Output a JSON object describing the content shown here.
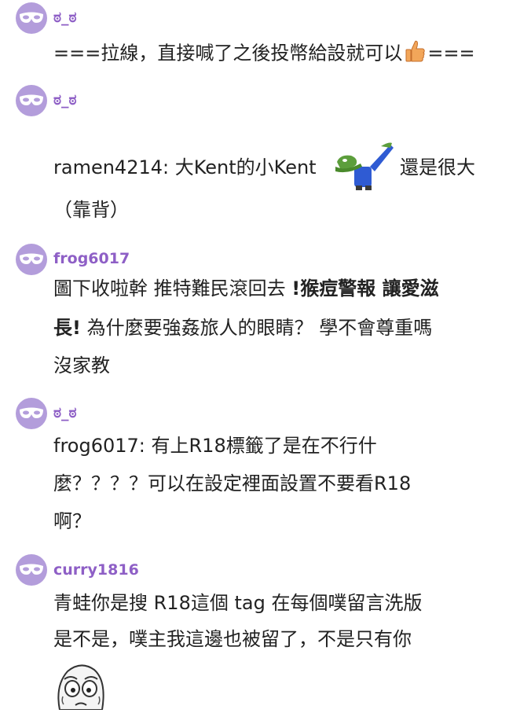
{
  "comments": [
    {
      "username": "ಠ_ಠ",
      "lines": [
        "===拉線，直接喊了之後投幣給設就可以",
        "==="
      ]
    },
    {
      "username": "ಠ_ಠ",
      "lines": [
        "ramen4214: 大Kent的小Kent",
        "還是很大",
        "（靠背）"
      ]
    },
    {
      "username": "frog6017",
      "lines": [
        "圖下收啦幹 推特難民滾回去 ",
        "!猴痘警報 讓愛滋",
        "長!",
        " 為什麼要強姦旅人的眼睛？ 學不會尊重嗎",
        "沒家教"
      ]
    },
    {
      "username": "ಠ_ಠ",
      "lines": [
        "frog6017: 有上R18標籤了是在不行什",
        "麼？？？？可以在設定裡面設置不要看R18",
        "啊？"
      ]
    },
    {
      "username": "curry1816",
      "lines": [
        "青蛙你是搜 R18這個 tag 在每個噗留言洗版",
        "是不是，噗主我這邊也被留了，不是只有你"
      ]
    }
  ],
  "icons": {
    "avatar": "mask-avatar-icon",
    "thumbs_up": "thumbs-up-emoji-icon",
    "frog_dab": "frog-dab-sticker-icon",
    "rage_face": "rage-face-sticker-icon"
  },
  "colors": {
    "avatar_bg": "#b39ddb",
    "username": "#8e5fc6",
    "text": "#222222",
    "background": "#ffffff"
  }
}
